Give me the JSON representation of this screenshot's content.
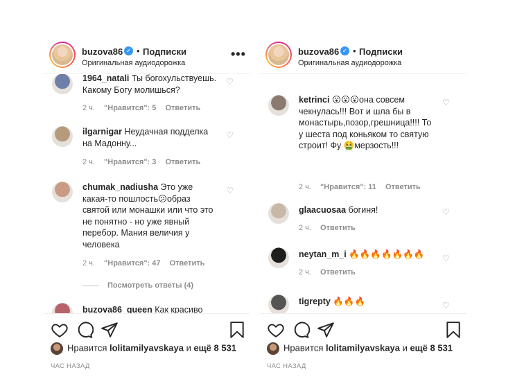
{
  "posts": [
    {
      "header": {
        "username": "buzova86",
        "dot": "•",
        "follow": "Подписки",
        "audio": "Оригинальная аудиодорожка",
        "more": "•••"
      },
      "comments": [
        {
          "user": "1964_natali",
          "text": " Ты богохульствуешь. Какому Богу молишься?",
          "time": "2 ч.",
          "likes": "\"Нравится\": 5",
          "reply": "Ответить",
          "avatar_color": "#6d7fa8"
        },
        {
          "user": "ilgarnigar",
          "text": " Неудачная подделка на Мадонну...",
          "time": "2 ч.",
          "likes": "\"Нравится\": 3",
          "reply": "Ответить",
          "avatar_color": "#b59a7c"
        },
        {
          "user": "chumak_nadiusha",
          "text": " Это уже какая-то пошлость😕образ святой или монашки или что это не понятно - но уже явный перебор. Мания величия у человека",
          "time": "2 ч.",
          "likes": "\"Нравится\": 47",
          "reply": "Ответить",
          "avatar_color": "#c99a86"
        },
        {
          "user": "buzova86_queen",
          "text": " Как красиво",
          "time": "",
          "likes": "",
          "reply": "",
          "avatar_color": "#b7636c"
        }
      ],
      "view_replies": "Посмотреть ответы (4)",
      "liked_by": {
        "prefix": "Нравится ",
        "user": "lolitamilyavskaya",
        "mid": " и ",
        "rest": "ещё 8 531"
      },
      "time_ago": "ЧАС НАЗАД"
    },
    {
      "header": {
        "username": "buzova86",
        "dot": "•",
        "follow": "Подписки",
        "audio": "Оригинальная аудиодорожка",
        "more": "•••"
      },
      "comments": [
        {
          "user": "ketrinci",
          "text": " 😮😮😮она совсем чекнулась!!! Вот и шла бы в монастырь,позор,грешница!!!! То у шеста под коньяком то святую строит! Фу 🤮мерзость!!!",
          "time": "2 ч.",
          "likes": "\"Нравится\": 11",
          "reply": "Ответить",
          "avatar_color": "#8a7a70"
        },
        {
          "user": "glaacuosaa",
          "text": " богиня!",
          "time": "2 ч.",
          "likes": "",
          "reply": "Ответить",
          "avatar_color": "#c8b8a8"
        },
        {
          "user": "neytan_m_i",
          "text": " 🔥🔥🔥🔥🔥🔥🔥",
          "time": "2 ч.",
          "likes": "",
          "reply": "Ответить",
          "avatar_color": "#1e1e1e"
        },
        {
          "user": "tigrepty",
          "text": " 🔥🔥🔥",
          "time": "",
          "likes": "",
          "reply": "",
          "avatar_color": "#555555"
        }
      ],
      "liked_by": {
        "prefix": "Нравится ",
        "user": "lolitamilyavskaya",
        "mid": " и ",
        "rest": "ещё 8 531"
      },
      "time_ago": "ЧАС НАЗАД"
    }
  ],
  "icons": {
    "heart": "heart-icon",
    "comment": "comment-icon",
    "share": "share-icon",
    "bookmark": "bookmark-icon",
    "verified": "verified-badge-icon"
  },
  "colors": {
    "text": "#262626",
    "muted": "#8e8e8e",
    "verified": "#3897f0",
    "border": "#efefef"
  }
}
